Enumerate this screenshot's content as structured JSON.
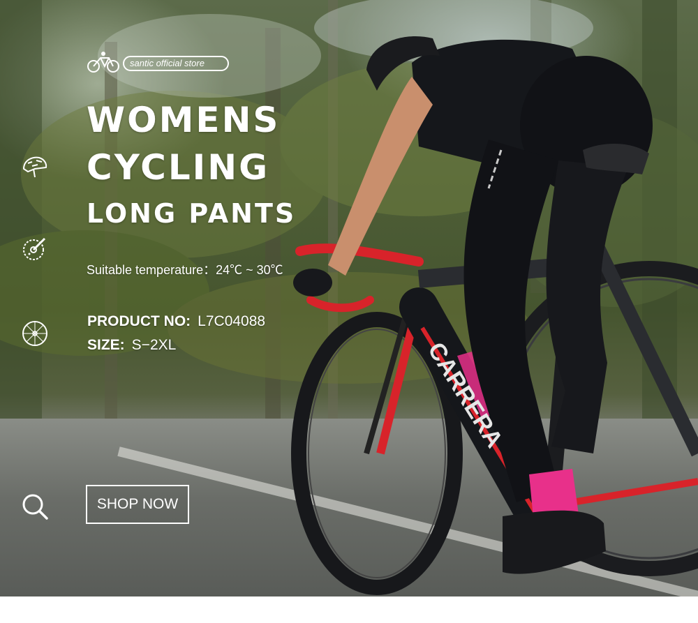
{
  "logo": {
    "store_name": "santic official store"
  },
  "headline": {
    "line1": "WOMENS",
    "line2": "CYCLING",
    "line3": "LONG PANTS"
  },
  "temperature": {
    "text": "Suitable temperature：24℃ ~ 30℃"
  },
  "specs": {
    "product_label": "PRODUCT NO:",
    "product_value": "L7C04088",
    "size_label": "SIZE:",
    "size_value": "S−2XL"
  },
  "cta": {
    "label": "SHOP NOW"
  },
  "icons": [
    "bike-icon",
    "helmet-icon",
    "crankset-icon",
    "wheel-icon",
    "search-icon"
  ],
  "bike_brand": "CARRERA",
  "colors": {
    "text": "#ffffff",
    "accent_pink": "#e8308a",
    "frame_red": "#d8232a",
    "jersey": "#15171b"
  }
}
